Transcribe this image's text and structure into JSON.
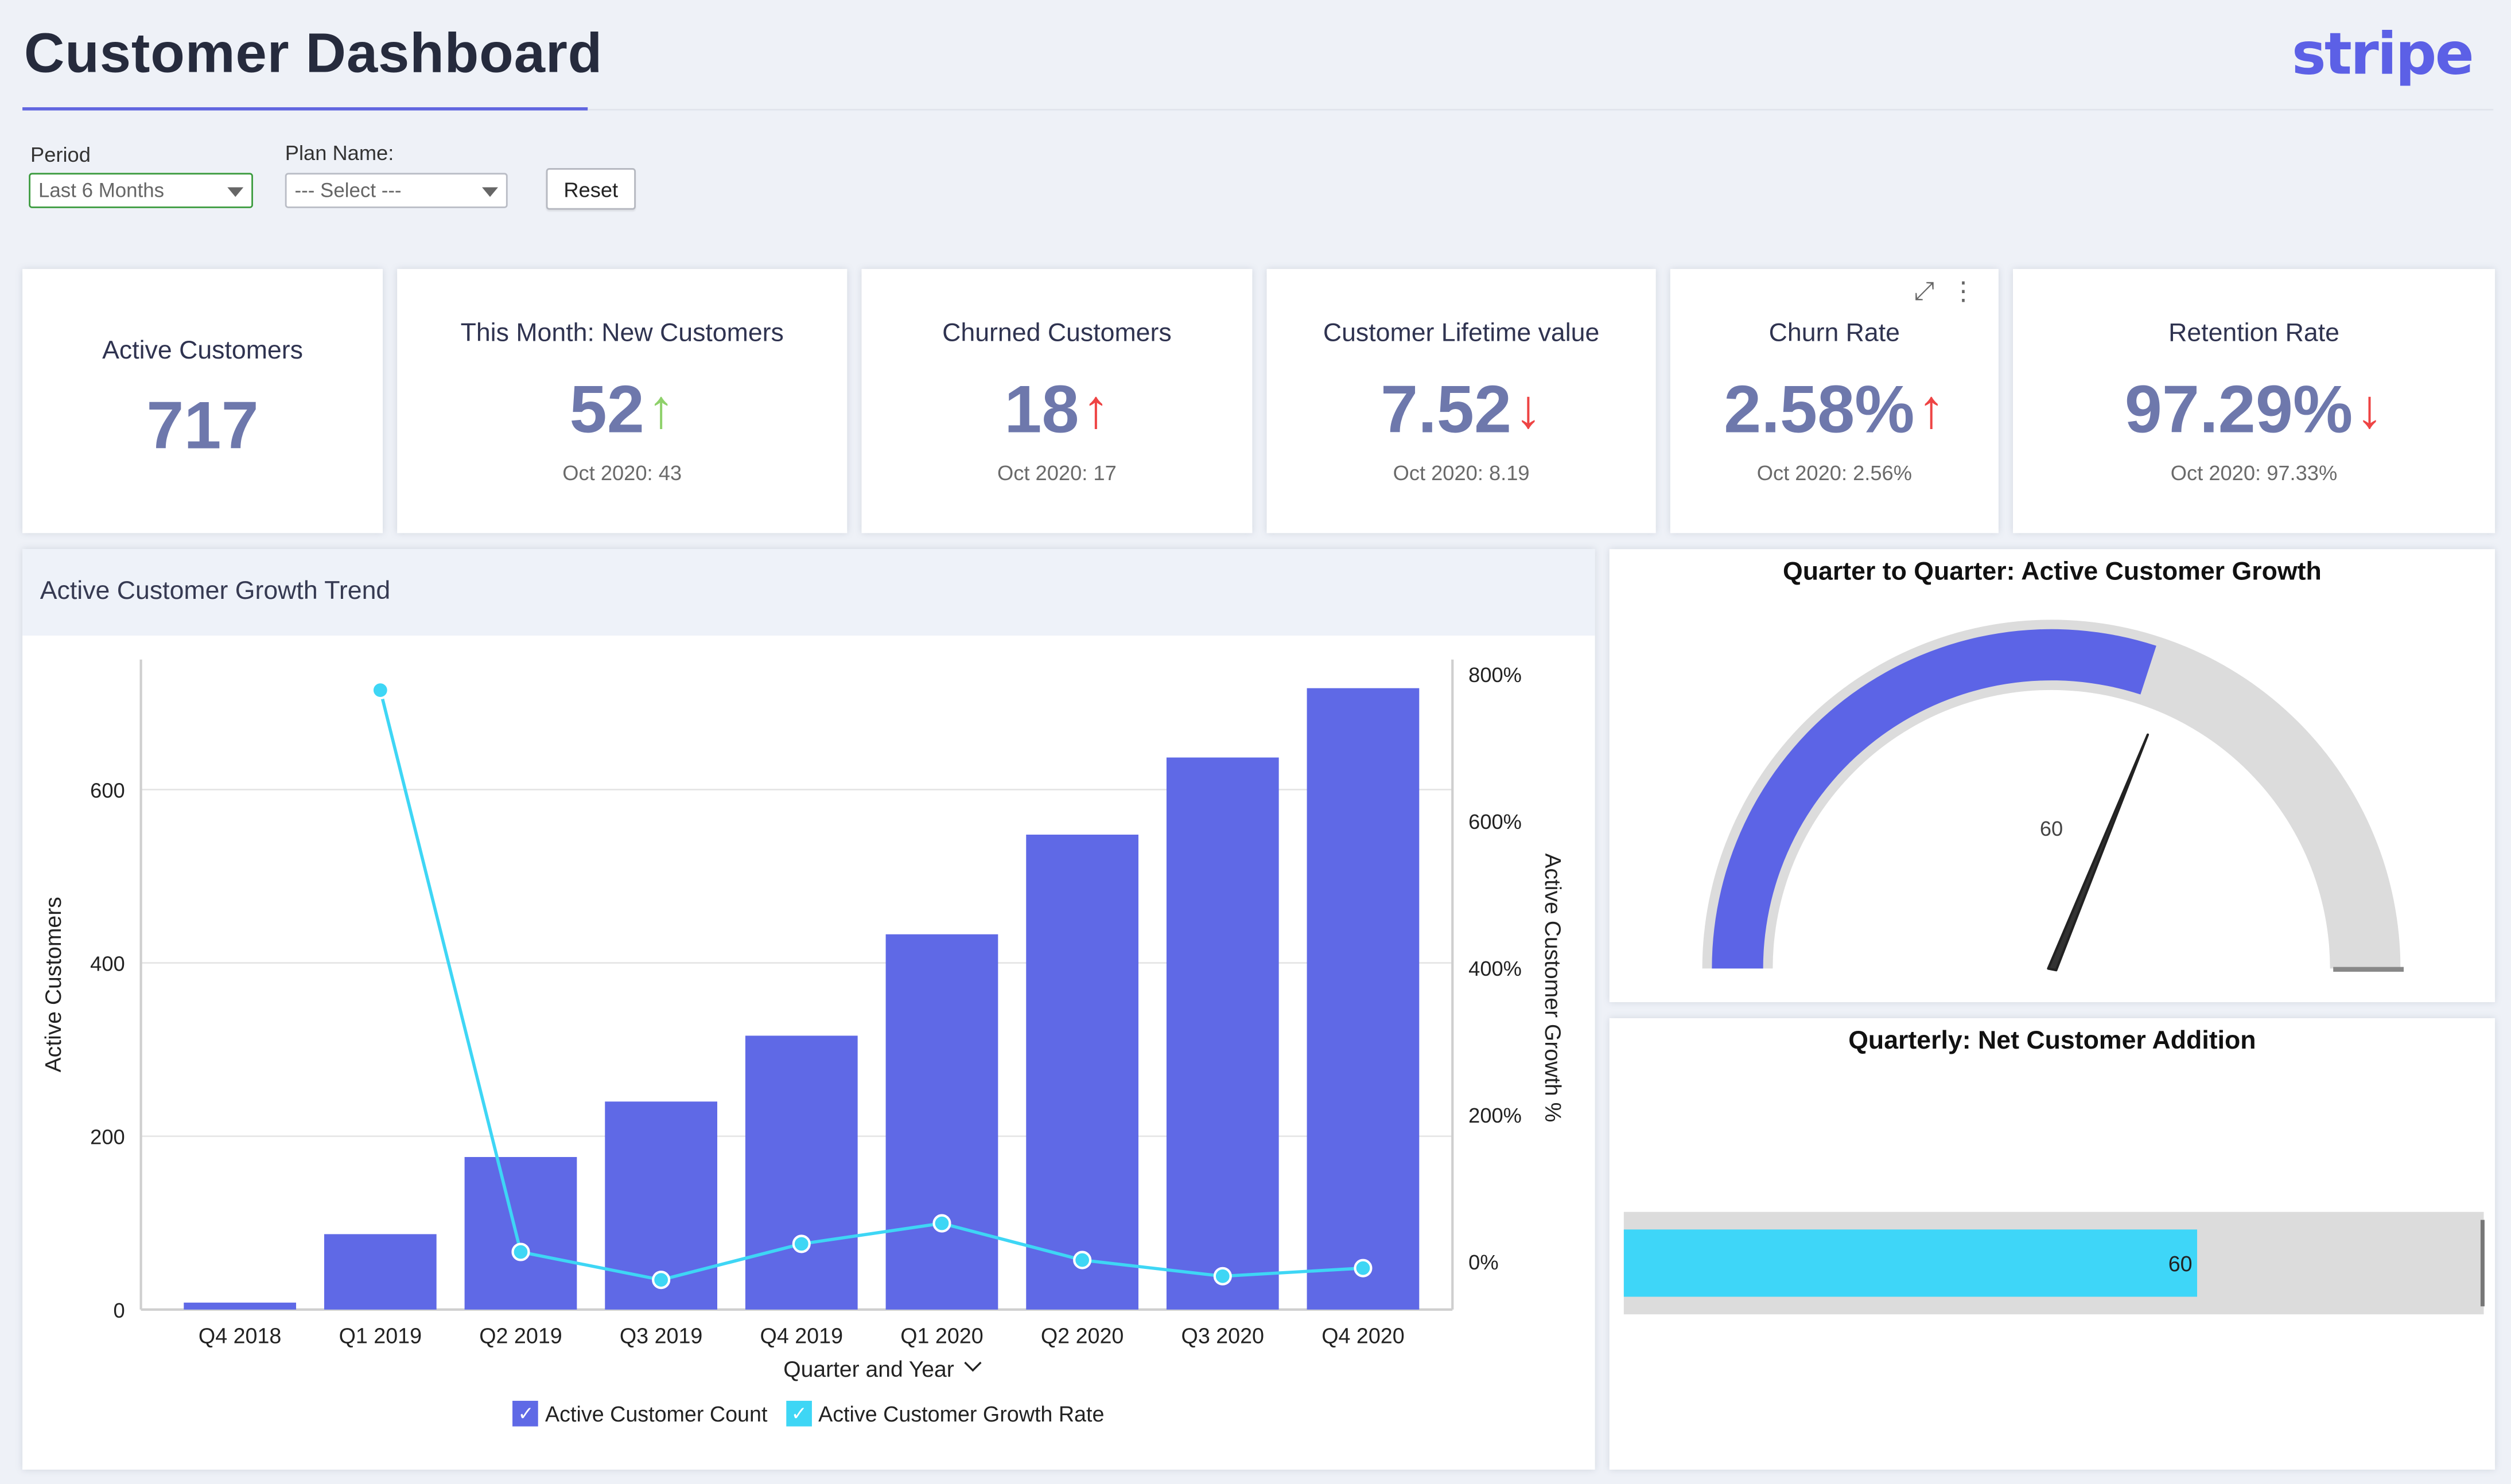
{
  "header": {
    "title": "Customer Dashboard",
    "logo_text": "stripe",
    "accent_color": "#6166e0"
  },
  "filters": {
    "period_label": "Period",
    "period_value": "Last 6 Months",
    "plan_label": "Plan Name:",
    "plan_value": "--- Select ---",
    "reset_label": "Reset"
  },
  "kpis": [
    {
      "title": "Active Customers",
      "value": "717",
      "arrow": "",
      "arrow_dir": "none",
      "sub": ""
    },
    {
      "title": "This Month: New Customers",
      "value": "52",
      "arrow": "↑",
      "arrow_dir": "up-green",
      "sub": "Oct 2020: 43"
    },
    {
      "title": "Churned Customers",
      "value": "18",
      "arrow": "↑",
      "arrow_dir": "up-red",
      "sub": "Oct 2020: 17"
    },
    {
      "title": "Customer Lifetime value",
      "value": "7.52",
      "arrow": "↓",
      "arrow_dir": "down-red",
      "sub": "Oct 2020: 8.19"
    },
    {
      "title": "Churn Rate",
      "value": "2.58%",
      "arrow": "↑",
      "arrow_dir": "up-red",
      "sub": "Oct 2020: 2.56%"
    },
    {
      "title": "Retention Rate",
      "value": "97.29%",
      "arrow": "↓",
      "arrow_dir": "down-red",
      "sub": "Oct 2020: 97.33%"
    }
  ],
  "card_tools": {
    "expand_icon": "⤢",
    "more_icon": "⋮"
  },
  "trend_panel": {
    "title": "Active Customer Growth Trend",
    "xlabel_chevron": "⌵"
  },
  "gauge_panel": {
    "title": "Quarter to Quarter: Active Customer Growth"
  },
  "bullet_panel": {
    "title": "Quarterly: Net Customer Addition"
  },
  "chart_data": [
    {
      "type": "bar",
      "title": "Active Customer Growth Trend",
      "xlabel": "Quarter and Year",
      "ylabel": "Active Customers",
      "y2label": "Active Customer Growth %",
      "categories": [
        "Q4 2018",
        "Q1 2019",
        "Q2 2019",
        "Q3 2019",
        "Q4 2019",
        "Q1 2020",
        "Q2 2020",
        "Q3 2020",
        "Q4 2020"
      ],
      "ylim": [
        0,
        750
      ],
      "yticks": [
        0,
        200,
        400,
        600
      ],
      "y2lim": [
        -68,
        820
      ],
      "y2ticks": [
        0,
        200,
        400,
        600,
        800
      ],
      "y2tick_labels": [
        "0%",
        "200%",
        "400%",
        "600%",
        "800%"
      ],
      "grid": true,
      "legend_position": "bottom",
      "series": [
        {
          "name": "Active Customer Count",
          "type": "bar",
          "axis": "left",
          "color": "#5f69e6",
          "values": [
            8,
            87,
            176,
            240,
            316,
            433,
            548,
            637,
            717
          ]
        },
        {
          "name": "Active Customer Growth Rate",
          "type": "line",
          "axis": "right",
          "color": "#3ed6f5",
          "values": [
            null,
            778,
            13,
            -25,
            24,
            52,
            2,
            -20,
            -9
          ]
        }
      ]
    },
    {
      "type": "gauge",
      "title": "Quarter to Quarter: Active Customer Growth",
      "value": 60,
      "value_label": "60",
      "range": [
        0,
        100
      ],
      "fill_color": "#5c64e6",
      "track_color": "#dcdcdc"
    },
    {
      "type": "bullet",
      "title": "Quarterly: Net Customer Addition",
      "value": 60,
      "value_label": "60",
      "range": [
        0,
        90
      ],
      "target": 90,
      "fill_color": "#3ed6f8",
      "track_color": "#dcdcdc"
    }
  ]
}
